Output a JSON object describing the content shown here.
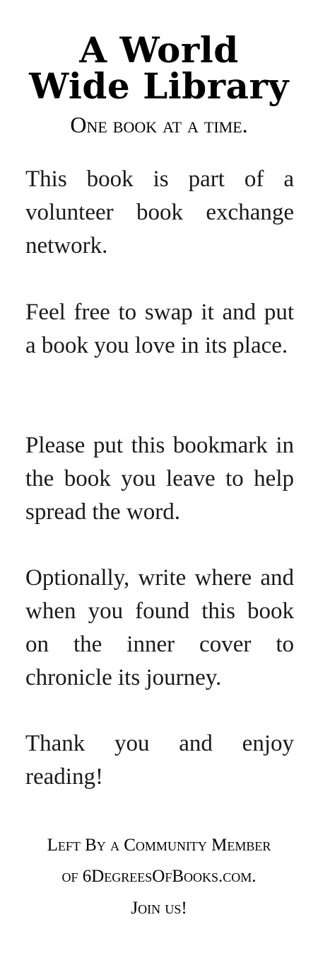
{
  "title": {
    "line1": "A World",
    "line2": "Wide Library"
  },
  "subtitle": "One book at a time.",
  "paragraphs": [
    "This book is part of a volunteer book exchange network.",
    "Feel free to swap it and put a book you love in its place.",
    "Please put this bookmark in the book you leave to help spread the word.",
    "Optionally, write where and when you found this book on the inner cover to chronicle its journey.",
    "Thank you and enjoy reading!"
  ],
  "footer": {
    "line1": "Left By a Community Member",
    "line2": "of 6DegreesOfBooks.com.",
    "line3": "Join us!"
  }
}
